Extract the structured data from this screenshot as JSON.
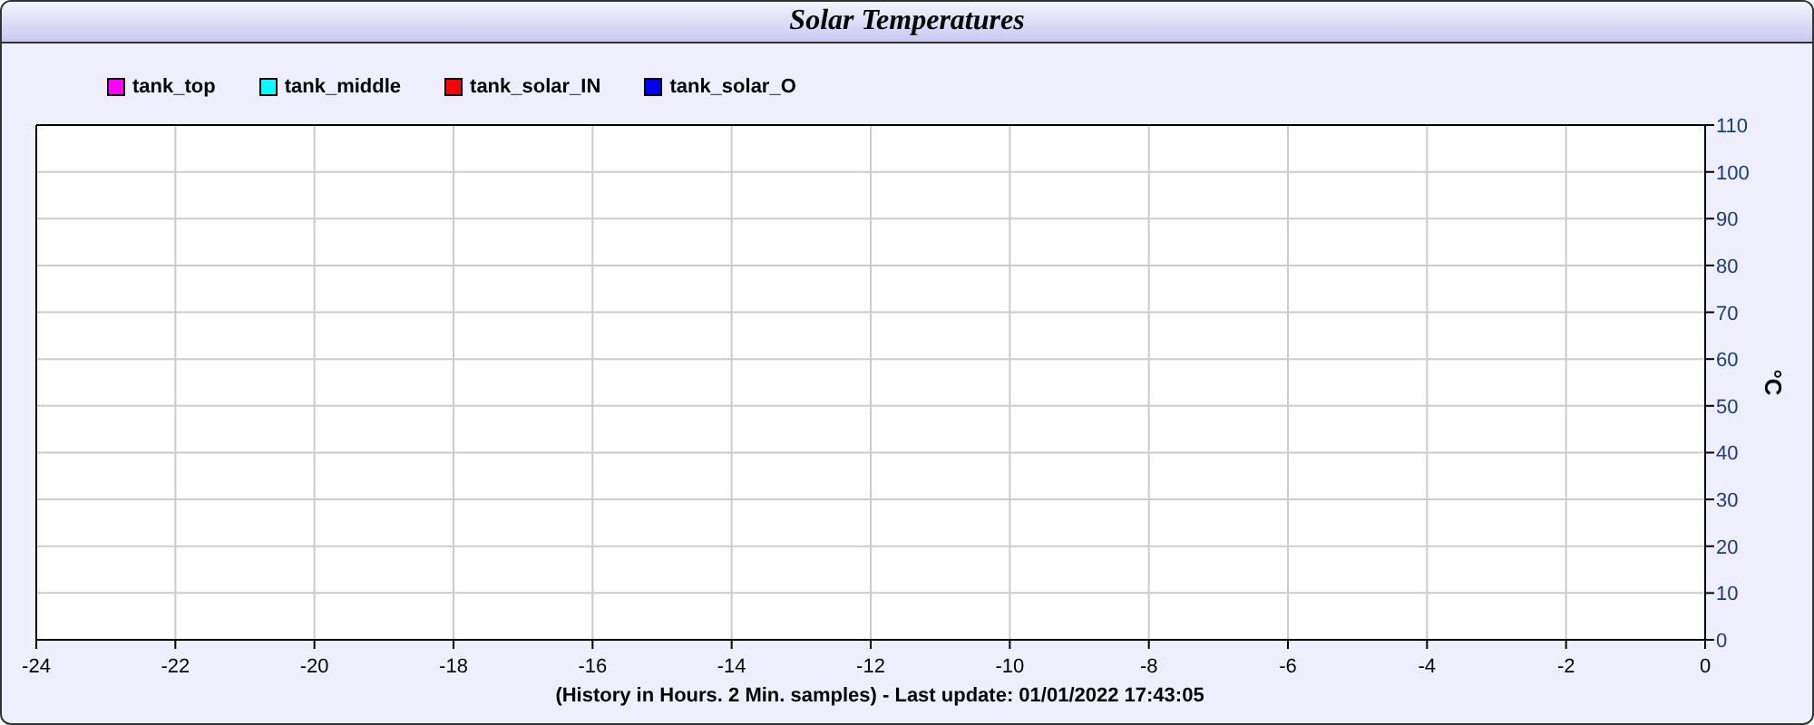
{
  "window": {
    "title": "Solar Temperatures"
  },
  "chart_data": {
    "type": "line",
    "ylabel": "°C",
    "xlabel": "(History in Hours. 2 Min. samples) - Last update: 01/01/2022 17:43:05",
    "series": [
      {
        "name": "tank_top",
        "color": "#ff00ff",
        "values": [
          null,
          null,
          null,
          null,
          null,
          null,
          null,
          null,
          null,
          null,
          null,
          null,
          null
        ]
      },
      {
        "name": "tank_middle",
        "color": "#00ffff",
        "values": [
          null,
          null,
          null,
          null,
          null,
          null,
          null,
          null,
          null,
          null,
          null,
          null,
          null
        ]
      },
      {
        "name": "tank_solar_IN",
        "color": "#ff0000",
        "values": [
          null,
          null,
          null,
          null,
          null,
          null,
          null,
          null,
          null,
          null,
          null,
          null,
          null
        ]
      },
      {
        "name": "tank_solar_O",
        "color": "#0000ff",
        "values": [
          null,
          null,
          null,
          null,
          null,
          null,
          null,
          null,
          null,
          null,
          null,
          null,
          null
        ]
      }
    ],
    "categories": [
      "-24",
      "-22",
      "-20",
      "-18",
      "-16",
      "-14",
      "-12",
      "-10",
      "-8",
      "-6",
      "-4",
      "-2",
      "0"
    ],
    "grid": true,
    "ylim": [
      0,
      110
    ],
    "yticks": [
      0,
      10,
      20,
      30,
      40,
      50,
      60,
      70,
      80,
      90,
      100,
      110
    ]
  }
}
